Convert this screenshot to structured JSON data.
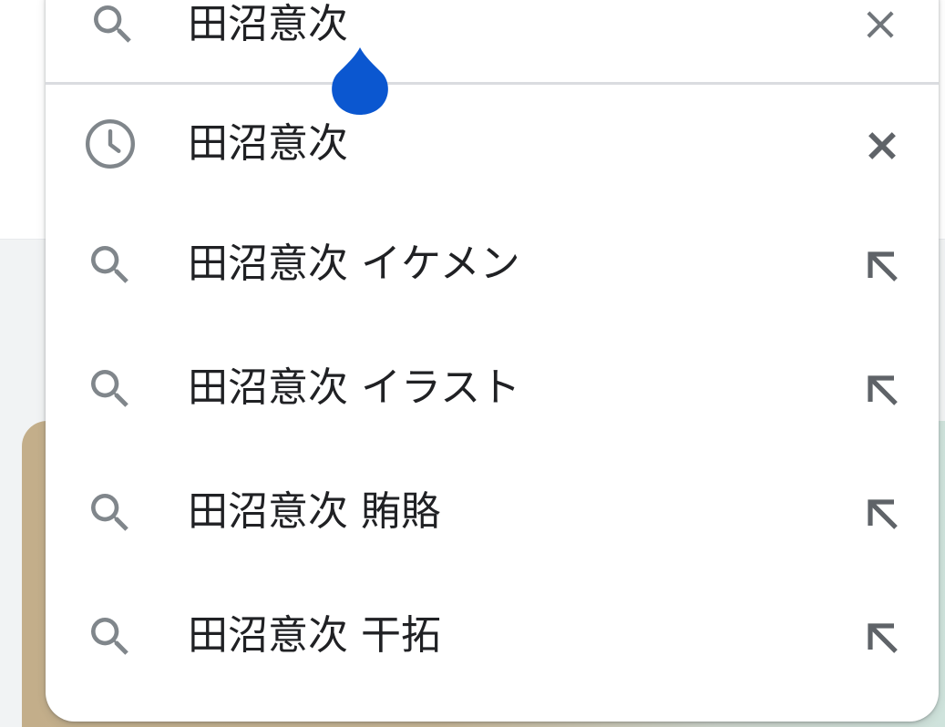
{
  "search": {
    "query": "田沼意次",
    "clear_icon": "close-icon",
    "search_icon": "search-icon",
    "caret_color": "#0b57d0"
  },
  "suggestions": [
    {
      "text": "田沼意次",
      "type": "history",
      "leading_icon": "history-icon",
      "action_icon": "remove-icon"
    },
    {
      "text": "田沼意次 イケメン",
      "type": "query",
      "leading_icon": "search-icon",
      "action_icon": "fill-query-arrow-icon"
    },
    {
      "text": "田沼意次 イラスト",
      "type": "query",
      "leading_icon": "search-icon",
      "action_icon": "fill-query-arrow-icon"
    },
    {
      "text": "田沼意次 賄賂",
      "type": "query",
      "leading_icon": "search-icon",
      "action_icon": "fill-query-arrow-icon"
    },
    {
      "text": "田沼意次 干拓",
      "type": "query",
      "leading_icon": "search-icon",
      "action_icon": "fill-query-arrow-icon"
    }
  ],
  "colors": {
    "text": "#202124",
    "icon": "#80868b",
    "accent": "#0b57d0",
    "divider": "#dadce0"
  }
}
